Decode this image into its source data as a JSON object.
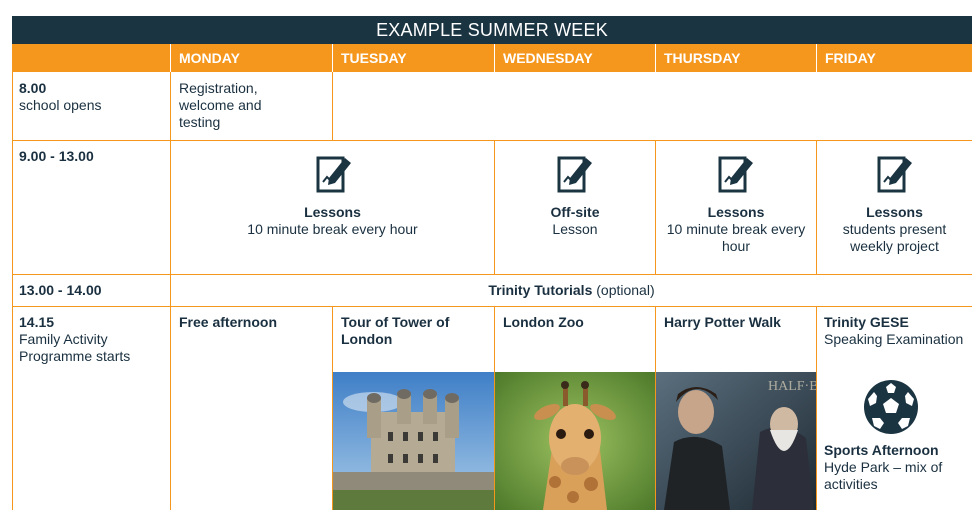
{
  "title": "EXAMPLE SUMMER WEEK",
  "days": [
    "MONDAY",
    "TUESDAY",
    "WEDNESDAY",
    "THURSDAY",
    "FRIDAY"
  ],
  "rows": {
    "r800": {
      "time": "8.00",
      "sub": "school opens",
      "monday": "Registration, welcome and testing"
    },
    "r900": {
      "time": "9.00 - 13.00",
      "mon_tue": {
        "title": "Lessons",
        "text": "10 minute break every hour"
      },
      "wednesday": {
        "title": "Off-site",
        "text": "Lesson"
      },
      "thursday": {
        "title": "Lessons",
        "text": "10 minute break every hour"
      },
      "friday": {
        "title": "Lessons",
        "text": "students present weekly project"
      }
    },
    "r1300": {
      "time": "13.00 - 14.00",
      "title": "Trinity Tutorials",
      "suffix": " (optional)"
    },
    "r1415": {
      "time": "14.15",
      "sub": "Family Activity Programme starts",
      "monday": "Free afternoon",
      "tuesday": "Tour of Tower of London",
      "wednesday": "London Zoo",
      "thursday": "Harry Potter Walk",
      "friday_title": "Trinity GESE",
      "friday_text": "Speaking Examination",
      "sports_title": "Sports Afternoon",
      "sports_text": "Hyde Park – mix of activities"
    }
  },
  "colors": {
    "navy": "#1b3442",
    "orange": "#f5961d",
    "text": "#1a3040"
  },
  "icons": {
    "lesson": "notepad-pen-icon",
    "sports": "soccer-ball-icon"
  }
}
